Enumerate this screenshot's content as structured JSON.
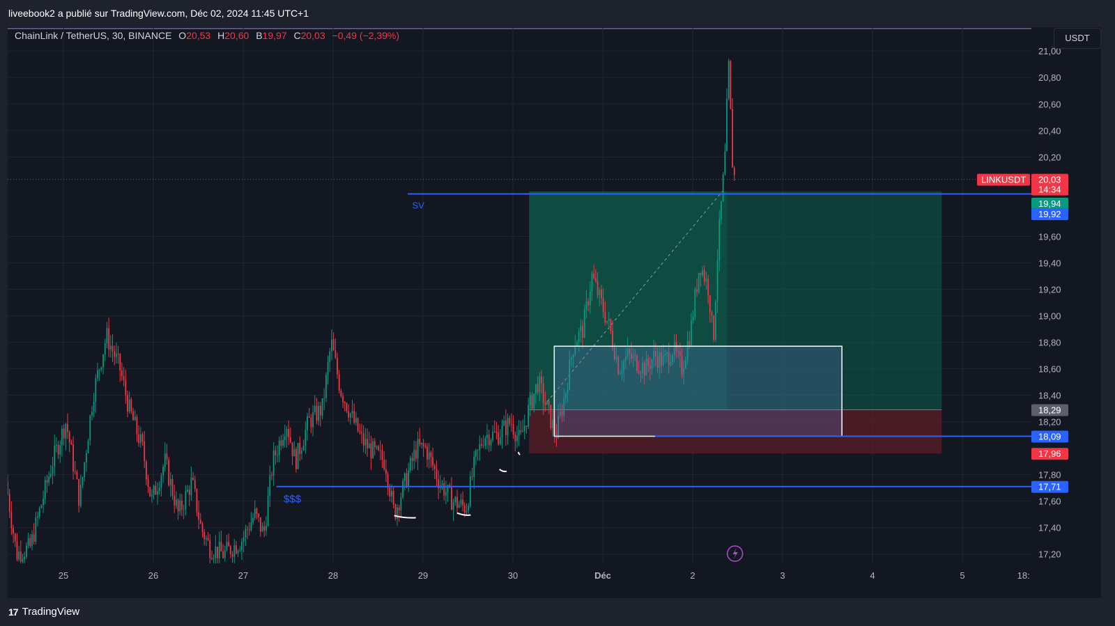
{
  "header": {
    "caption": "liveebook2 a publié sur TradingView.com, Déc 02, 2024 11:45 UTC+1"
  },
  "legend": {
    "symbol": "ChainLink / TetherUS, 30, BINANCE",
    "open_key": "O",
    "open": "20,53",
    "high_key": "H",
    "high": "20,60",
    "low_key": "B",
    "low": "19,97",
    "close_key": "C",
    "close": "20,03",
    "change": "−0,49 (−2,39%)"
  },
  "currency_button": "USDT",
  "footer": {
    "logo_text": "TradingView",
    "logo_mark": "17"
  },
  "colors": {
    "background": "#131722",
    "grid": "#1f2433",
    "up": "#089981",
    "down": "#f23645",
    "level_line": "#2962ff",
    "profit_zone": "#0d5c4a",
    "loss_zone": "#5c1e27",
    "last_price_line": "#f23645"
  },
  "chart_data": {
    "type": "candlestick",
    "symbol": "LINKUSDT",
    "timeframe": "30",
    "exchange": "BINANCE",
    "x_ticks": [
      {
        "label": "25",
        "day": 0
      },
      {
        "label": "26",
        "day": 1
      },
      {
        "label": "27",
        "day": 2
      },
      {
        "label": "28",
        "day": 3
      },
      {
        "label": "29",
        "day": 4
      },
      {
        "label": "30",
        "day": 5
      },
      {
        "label": "Déc",
        "day": 6
      },
      {
        "label": "2",
        "day": 7
      },
      {
        "label": "3",
        "day": 8
      },
      {
        "label": "4",
        "day": 9
      },
      {
        "label": "5",
        "day": 10
      },
      {
        "label": "18:",
        "day": 10.68
      }
    ],
    "y_ticks": [
      "21,00",
      "20,80",
      "20,60",
      "20,40",
      "20,20",
      "19,60",
      "19,40",
      "19,20",
      "19,00",
      "18,80",
      "18,60",
      "18,40",
      "18,20",
      "17,80",
      "17,60",
      "17,40",
      "17,20"
    ],
    "y_tick_values": [
      21.0,
      20.8,
      20.6,
      20.4,
      20.2,
      19.6,
      19.4,
      19.2,
      19.0,
      18.8,
      18.6,
      18.4,
      18.2,
      17.8,
      17.6,
      17.4,
      17.2
    ],
    "ylim": [
      17.13,
      21.18
    ],
    "xlim_days": [
      -0.62,
      10.7
    ],
    "anchor_points": [
      [
        -0.62,
        17.75
      ],
      [
        -0.5,
        17.2
      ],
      [
        -0.35,
        17.25
      ],
      [
        -0.1,
        17.9
      ],
      [
        0.05,
        18.2
      ],
      [
        0.2,
        17.6
      ],
      [
        0.35,
        18.4
      ],
      [
        0.5,
        18.85
      ],
      [
        0.65,
        18.6
      ],
      [
        0.75,
        18.3
      ],
      [
        0.9,
        18.0
      ],
      [
        1.0,
        17.6
      ],
      [
        1.15,
        17.9
      ],
      [
        1.3,
        17.5
      ],
      [
        1.45,
        17.75
      ],
      [
        1.55,
        17.4
      ],
      [
        1.65,
        17.25
      ],
      [
        1.8,
        17.2
      ],
      [
        2.0,
        17.3
      ],
      [
        2.15,
        17.5
      ],
      [
        2.25,
        17.35
      ],
      [
        2.35,
        17.9
      ],
      [
        2.5,
        18.2
      ],
      [
        2.6,
        17.9
      ],
      [
        2.75,
        18.2
      ],
      [
        2.9,
        18.3
      ],
      [
        3.0,
        18.8
      ],
      [
        3.1,
        18.45
      ],
      [
        3.25,
        18.2
      ],
      [
        3.35,
        18.05
      ],
      [
        3.5,
        17.95
      ],
      [
        3.6,
        17.9
      ],
      [
        3.7,
        17.5
      ],
      [
        3.85,
        17.8
      ],
      [
        3.95,
        18.0
      ],
      [
        4.05,
        18.0
      ],
      [
        4.2,
        17.75
      ],
      [
        4.35,
        17.6
      ],
      [
        4.5,
        17.55
      ],
      [
        4.6,
        17.9
      ],
      [
        4.7,
        18.1
      ],
      [
        4.85,
        18.1
      ],
      [
        5.0,
        18.2
      ],
      [
        5.1,
        18.05
      ],
      [
        5.2,
        18.3
      ],
      [
        5.3,
        18.5
      ],
      [
        5.4,
        18.3
      ],
      [
        5.5,
        18.1
      ],
      [
        5.6,
        18.4
      ],
      [
        5.7,
        18.8
      ],
      [
        5.8,
        18.9
      ],
      [
        5.9,
        19.3
      ],
      [
        6.0,
        19.1
      ],
      [
        6.1,
        18.9
      ],
      [
        6.2,
        18.6
      ],
      [
        6.3,
        18.7
      ],
      [
        6.4,
        18.65
      ],
      [
        6.5,
        18.6
      ],
      [
        6.6,
        18.7
      ],
      [
        6.7,
        18.65
      ],
      [
        6.8,
        18.75
      ],
      [
        6.9,
        18.6
      ],
      [
        7.0,
        18.9
      ],
      [
        7.1,
        19.4
      ],
      [
        7.2,
        19.2
      ],
      [
        7.25,
        18.8
      ],
      [
        7.3,
        19.5
      ],
      [
        7.38,
        20.2
      ],
      [
        7.42,
        20.9
      ],
      [
        7.47,
        20.05
      ]
    ],
    "annotations": [
      {
        "text": "SV",
        "type": "label"
      },
      {
        "text": "$$$",
        "type": "label"
      }
    ],
    "levels": [
      {
        "price": 19.92,
        "label": "19,92",
        "from_day": 3.83,
        "color": "#2962ff"
      },
      {
        "price": 18.09,
        "label": "18,09",
        "from_day": 6.58,
        "color": "#2962ff"
      },
      {
        "price": 17.71,
        "label": "17,71",
        "from_day": 2.37,
        "color": "#2962ff"
      }
    ],
    "price_labels": [
      {
        "text": "LINKUSDT",
        "price": 20.03,
        "color": "#f23645",
        "side": "left"
      },
      {
        "text": "20,03",
        "price": 20.03,
        "color": "#f23645"
      },
      {
        "text": "14:34",
        "price": 19.94,
        "color": "#f23645",
        "offset": 14
      },
      {
        "text": "19,94",
        "price": 19.85,
        "color": "#089981"
      },
      {
        "text": "19,92",
        "price": 19.77,
        "color": "#2962ff"
      },
      {
        "text": "18,29",
        "price": 18.29,
        "color": "#5d606b"
      },
      {
        "text": "18,09",
        "price": 18.09,
        "color": "#2962ff"
      },
      {
        "text": "17,96",
        "price": 17.96,
        "color": "#f23645"
      },
      {
        "text": "17,71",
        "price": 17.71,
        "color": "#2962ff"
      }
    ],
    "long_position": {
      "entry": 18.29,
      "target": 19.94,
      "stop": 17.96,
      "from_day": 5.18,
      "to_day": 9.77,
      "entry_to_day": 7.38
    },
    "rectangle": {
      "top": 18.77,
      "bottom": 18.09,
      "from_day": 5.46,
      "to_day": 8.66
    },
    "last_price": 20.03
  }
}
